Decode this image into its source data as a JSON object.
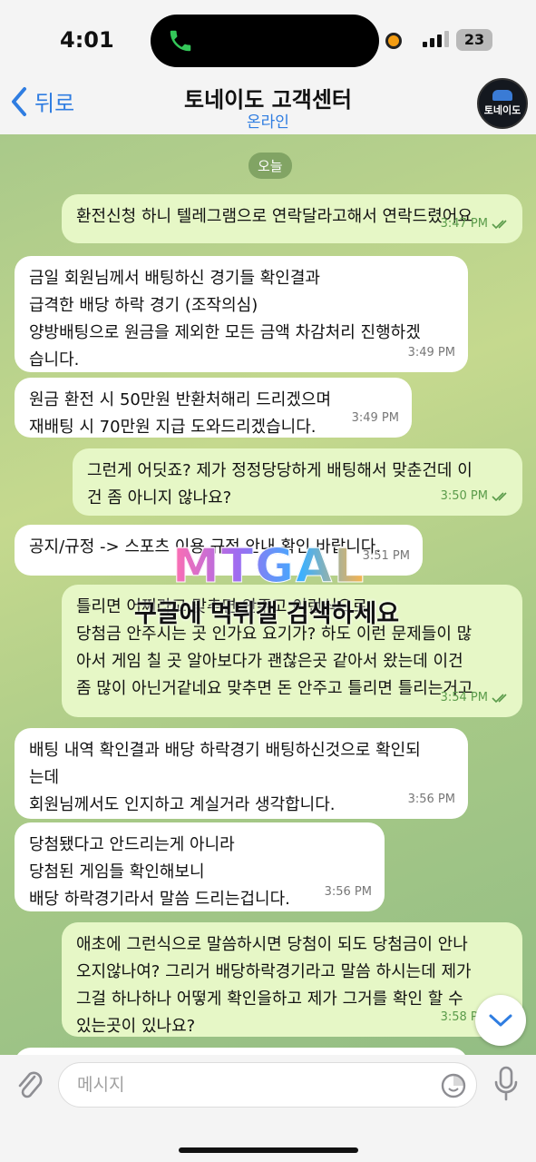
{
  "status_bar": {
    "time": "4:01",
    "battery": "23"
  },
  "header": {
    "back_label": "뒤로",
    "title": "토네이도 고객센터",
    "subtitle": "온라인",
    "avatar_text": "토네이도"
  },
  "chat": {
    "date_pill": "오늘",
    "messages": [
      {
        "direction": "out",
        "text": "환전신청 하니 텔레그램으로 연락달라고해서 연락드렸어요",
        "time": "3:47 PM",
        "read": true
      },
      {
        "direction": "in",
        "text": "금일 회원님께서 배팅하신 경기들 확인결과\n급격한 배당 하락 경기 (조작의심)\n양방배팅으로 원금을 제외한 모든 금액 차감처리 진행하겠\n습니다.",
        "time": "3:49 PM"
      },
      {
        "direction": "in",
        "text": "원금 환전 시 50만원 반환처해리 드리겠으며\n재배팅 시 70만원 지급 도와드리겠습니다.",
        "time": "3:49 PM"
      },
      {
        "direction": "out",
        "text": "그런게 어딧죠? 제가 정정당당하게 배팅해서 맞춘건데 이\n건 좀 아니지 않나요?",
        "time": "3:50 PM",
        "read": true
      },
      {
        "direction": "in",
        "text": "공지/규정 -> 스포츠 이용 규정 안내 확인 바랍니다.",
        "time": "3:51 PM"
      },
      {
        "direction": "out",
        "text": "틀리면 어쩌라고 맞추면 안주고 이런식으로\n당첨금 안주시는 곳 인가요 요기가? 하도 이런 문제들이 많\n아서 게임 칠 곳 알아보다가 괜찮은곳 같아서 왔는데 이건\n좀 많이 아닌거같네요 맞추면 돈 안주고 틀리면 틀리는거고",
        "time": "3:54 PM",
        "read": true
      },
      {
        "direction": "in",
        "text": "배팅 내역 확인결과 배당 하락경기 배팅하신것으로 확인되\n는데\n회원님께서도 인지하고 계실거라 생각합니다.",
        "time": "3:56 PM"
      },
      {
        "direction": "in",
        "text": "당첨됐다고 안드리는게 아니라\n당첨된 게임들 확인해보니\n배당 하락경기라서 말씀 드리는겁니다.",
        "time": "3:56 PM"
      },
      {
        "direction": "out",
        "text": "애초에 그런식으로 말씀하시면 당첨이 되도 당첨금이 안나\n오지않나여? 그리거 배당하락경기라고 말씀 하시는데 제가\n그걸 하나하나 어떻게 확인을하고 제가 그거를 확인 할 수\n있는곳이 있나요?",
        "time": "3:58 PM",
        "read": true
      }
    ]
  },
  "watermark": {
    "logo": "MTGAL",
    "text": "구글에 먹튀갤 검색하세요"
  },
  "input": {
    "placeholder": "메시지"
  },
  "colors": {
    "accent": "#2f7de1",
    "out_bubble": "#e6f7c6",
    "in_bubble": "#ffffff",
    "read_check": "#5a9b4a"
  }
}
